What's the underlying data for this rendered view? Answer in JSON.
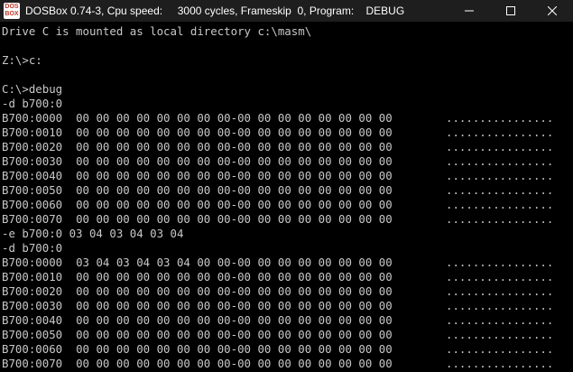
{
  "window": {
    "icon_top": "DOS",
    "icon_bottom": "BOX",
    "title": "DOSBox 0.74-3, Cpu speed:     3000 cycles, Frameskip  0, Program:    DEBUG",
    "colors": {
      "titlebar_bg": "#1e1e1e",
      "title_text": "#ffffff",
      "screen_bg": "#000000",
      "screen_text": "#c8c8c8"
    }
  },
  "console": {
    "lines": [
      {
        "type": "text",
        "text": "Drive C is mounted as local directory c:\\masm\\"
      },
      {
        "type": "text",
        "text": ""
      },
      {
        "type": "text",
        "text": "Z:\\>c:"
      },
      {
        "type": "text",
        "text": ""
      },
      {
        "type": "text",
        "text": "C:\\>debug"
      },
      {
        "type": "text",
        "text": "-d b700:0"
      },
      {
        "type": "dump",
        "addr": "B700:0000",
        "hex": "00 00 00 00 00 00 00 00-00 00 00 00 00 00 00 00",
        "ascii": "................"
      },
      {
        "type": "dump",
        "addr": "B700:0010",
        "hex": "00 00 00 00 00 00 00 00-00 00 00 00 00 00 00 00",
        "ascii": "................"
      },
      {
        "type": "dump",
        "addr": "B700:0020",
        "hex": "00 00 00 00 00 00 00 00-00 00 00 00 00 00 00 00",
        "ascii": "................"
      },
      {
        "type": "dump",
        "addr": "B700:0030",
        "hex": "00 00 00 00 00 00 00 00-00 00 00 00 00 00 00 00",
        "ascii": "................"
      },
      {
        "type": "dump",
        "addr": "B700:0040",
        "hex": "00 00 00 00 00 00 00 00-00 00 00 00 00 00 00 00",
        "ascii": "................"
      },
      {
        "type": "dump",
        "addr": "B700:0050",
        "hex": "00 00 00 00 00 00 00 00-00 00 00 00 00 00 00 00",
        "ascii": "................"
      },
      {
        "type": "dump",
        "addr": "B700:0060",
        "hex": "00 00 00 00 00 00 00 00-00 00 00 00 00 00 00 00",
        "ascii": "................"
      },
      {
        "type": "dump",
        "addr": "B700:0070",
        "hex": "00 00 00 00 00 00 00 00-00 00 00 00 00 00 00 00",
        "ascii": "................"
      },
      {
        "type": "text",
        "text": "-e b700:0 03 04 03 04 03 04"
      },
      {
        "type": "text",
        "text": "-d b700:0"
      },
      {
        "type": "dump",
        "addr": "B700:0000",
        "hex": "03 04 03 04 03 04 00 00-00 00 00 00 00 00 00 00",
        "ascii": "................"
      },
      {
        "type": "dump",
        "addr": "B700:0010",
        "hex": "00 00 00 00 00 00 00 00-00 00 00 00 00 00 00 00",
        "ascii": "................"
      },
      {
        "type": "dump",
        "addr": "B700:0020",
        "hex": "00 00 00 00 00 00 00 00-00 00 00 00 00 00 00 00",
        "ascii": "................"
      },
      {
        "type": "dump",
        "addr": "B700:0030",
        "hex": "00 00 00 00 00 00 00 00-00 00 00 00 00 00 00 00",
        "ascii": "................"
      },
      {
        "type": "dump",
        "addr": "B700:0040",
        "hex": "00 00 00 00 00 00 00 00-00 00 00 00 00 00 00 00",
        "ascii": "................"
      },
      {
        "type": "dump",
        "addr": "B700:0050",
        "hex": "00 00 00 00 00 00 00 00-00 00 00 00 00 00 00 00",
        "ascii": "................"
      },
      {
        "type": "dump",
        "addr": "B700:0060",
        "hex": "00 00 00 00 00 00 00 00-00 00 00 00 00 00 00 00",
        "ascii": "................"
      },
      {
        "type": "dump",
        "addr": "B700:0070",
        "hex": "00 00 00 00 00 00 00 00-00 00 00 00 00 00 00 00",
        "ascii": "................"
      }
    ]
  }
}
